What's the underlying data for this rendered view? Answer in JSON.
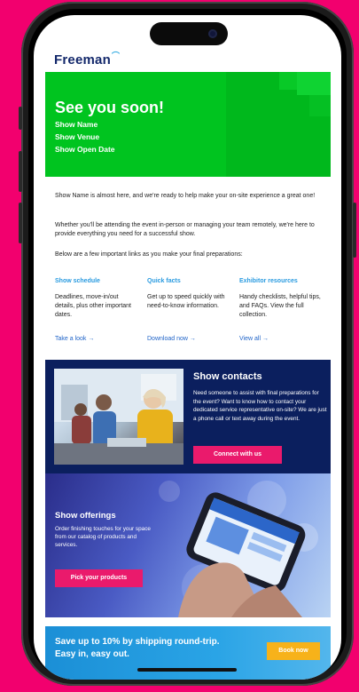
{
  "brand": {
    "logo_text": "Freeman"
  },
  "hero": {
    "title": "See you soon!",
    "lines": [
      "Show Name",
      "Show Venue",
      "Show Open Date"
    ]
  },
  "intro": {
    "p1": "Show Name is almost here, and we're ready to help make your on-site experience a great one!",
    "p2": "Whether you'll be attending the event in-person or managing your team remotely, we're here to provide everything you need for a successful show.",
    "p3": "Below are a few important links as you make your final preparations:"
  },
  "columns": [
    {
      "heading": "Show schedule",
      "desc": "Deadlines, move-in/out details, plus other important dates.",
      "link": "Take a look →"
    },
    {
      "heading": "Quick facts",
      "desc": "Get up to speed quickly with need-to-know information.",
      "link": "Download now →"
    },
    {
      "heading": "Exhibitor resources",
      "desc": "Handy checklists, helpful tips, and FAQs. View the full collection.",
      "link": "View all →"
    }
  ],
  "contacts": {
    "title": "Show contacts",
    "text": "Need someone to assist with final preparations for the event? Want to know how to contact your dedicated service representative on-site? We are just a phone call or text away during the event.",
    "button": "Connect with us"
  },
  "offerings": {
    "title": "Show offerings",
    "text": "Order finishing touches for your space from our catalog of products and services.",
    "button": "Pick your products"
  },
  "shipping": {
    "line1": "Save up to 10% by shipping round-trip.",
    "line2": "Easy in, easy out.",
    "button": "Book now"
  },
  "colors": {
    "background": "#f2006e",
    "hero_green": "#00c41f",
    "navy": "#0b1f5e",
    "accent_pink": "#ea1a6c",
    "link_blue": "#2a9be0",
    "book_orange": "#f7b21a"
  }
}
